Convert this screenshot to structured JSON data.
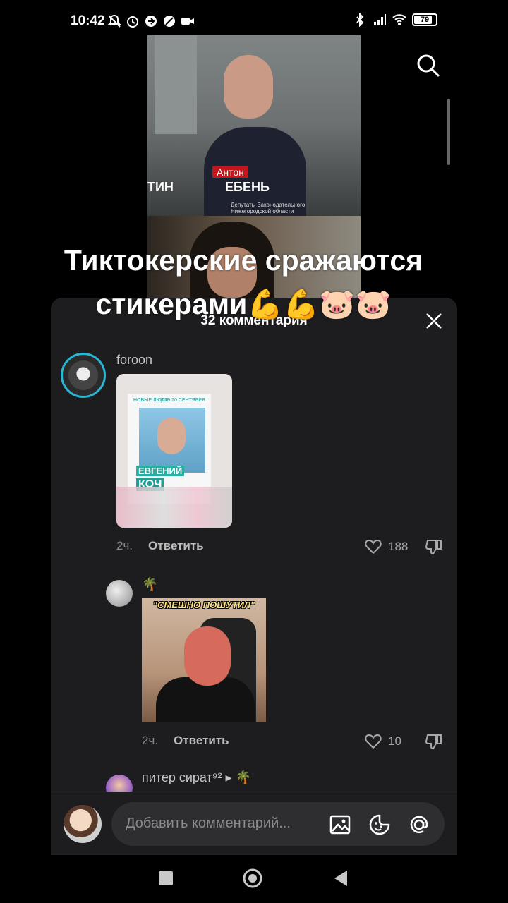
{
  "status": {
    "time": "10:42",
    "battery": "79"
  },
  "video": {
    "poster_first_name": "Антон",
    "poster_last_name": "ЕБЕНЬ",
    "poster_left_name": "ТИН",
    "poster_sub": "Депутаты Законодательного Нижегородской области",
    "caption": "Тиктокерские сражаются стикерами💪💪🐷🐷"
  },
  "comments_sheet": {
    "title": "32 комментария",
    "comments": [
      {
        "username": "foroon",
        "sticker": {
          "party": "НОВЫЕ ЛЮДИ",
          "date": "18.19.20 СЕНТЯБРЯ",
          "name_first": "ЕВГЕНИЙ",
          "name_last": "КОЧ"
        },
        "time": "2ч.",
        "reply_label": "Ответить",
        "likes": "188"
      },
      {
        "username": "🌴",
        "sticker": {
          "caption": "\"СМЕШНО ПОШУТИЛ\""
        },
        "time": "2ч.",
        "reply_label": "Ответить",
        "likes": "10"
      },
      {
        "username": "питер сират⁹² ▸ 🌴"
      }
    ]
  },
  "input": {
    "placeholder": "Добавить комментарий..."
  }
}
